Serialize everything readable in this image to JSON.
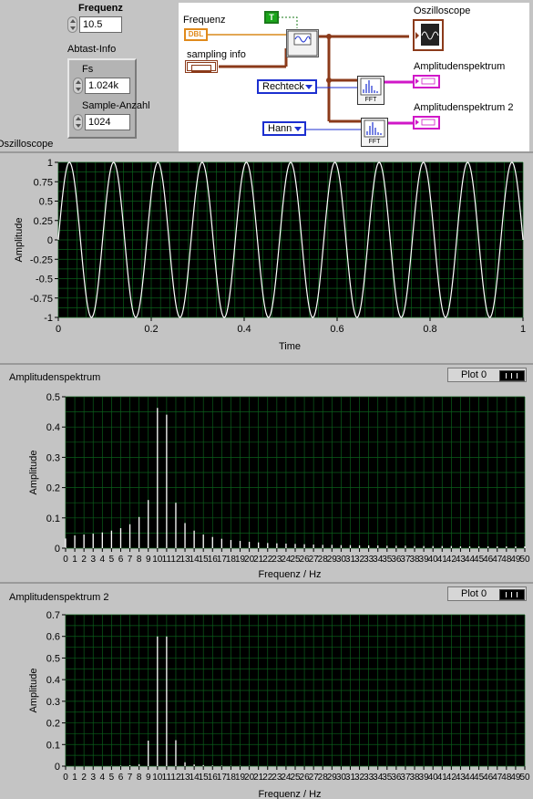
{
  "front_panel": {
    "frequenz": {
      "label": "Frequenz",
      "value": "10.5"
    },
    "abtast_info": {
      "label": "Abtast-Info",
      "fs": {
        "label": "Fs",
        "value": "1.024k"
      },
      "samples": {
        "label": "Sample-Anzahl",
        "value": "1024"
      }
    }
  },
  "block_diagram": {
    "frequenz_label": "Frequenz",
    "frequenz_type": "DBL",
    "sampling_label": "sampling info",
    "bool_const": "T",
    "oszilloscope_label": "Oszilloscope",
    "spectrum1_label": "Amplitudenspektrum",
    "spectrum2_label": "Amplitudenspektrum 2",
    "window1": "Rechteck",
    "window2": "Hann",
    "fft_label": "FFT"
  },
  "graphs": {
    "oszilloscope": {
      "title": "Oszilloscope",
      "xlabel": "Time",
      "ylabel": "Amplitude"
    },
    "spectrum1": {
      "title": "Amplitudenspektrum",
      "legend": "Plot 0",
      "xlabel": "Frequenz / Hz",
      "ylabel": "Amplitude"
    },
    "spectrum2": {
      "title": "Amplitudenspektrum 2",
      "legend": "Plot 0",
      "xlabel": "Frequenz / Hz",
      "ylabel": "Amplitude"
    }
  },
  "chart_data": [
    {
      "type": "line",
      "name": "oszilloscope",
      "title": "Oszilloscope",
      "xlabel": "Time",
      "ylabel": "Amplitude",
      "xlim": [
        0,
        1
      ],
      "ylim": [
        -1,
        1
      ],
      "frequency_hz": 10.5,
      "samples": 1024,
      "xticks": [
        "0",
        "0.2",
        "0.4",
        "0.6",
        "0.8",
        "1"
      ],
      "yticks": [
        "1",
        "0.75",
        "0.5",
        "0.25",
        "0",
        "-0.25",
        "-0.5",
        "-0.75",
        "-1"
      ],
      "grid": true
    },
    {
      "type": "bar",
      "name": "spectrum1",
      "title": "Amplitudenspektrum",
      "xlabel": "Frequenz / Hz",
      "ylabel": "Amplitude",
      "xlim": [
        0,
        50
      ],
      "ylim": [
        0,
        0.5
      ],
      "yticks": [
        "0.5",
        "0.4",
        "0.3",
        "0.2",
        "0.1",
        "0"
      ],
      "x": [
        0,
        1,
        2,
        3,
        4,
        5,
        6,
        7,
        8,
        9,
        10,
        11,
        12,
        13,
        14,
        15,
        16,
        17,
        18,
        19,
        20,
        21,
        22,
        23,
        24,
        25,
        26,
        27,
        28,
        29,
        30,
        31,
        32,
        33,
        34,
        35,
        36,
        37,
        38,
        39,
        40,
        41,
        42,
        43,
        44,
        45,
        46,
        47,
        48,
        49,
        50
      ],
      "values": [
        0.032,
        0.042,
        0.045,
        0.048,
        0.052,
        0.058,
        0.066,
        0.079,
        0.103,
        0.159,
        0.463,
        0.441,
        0.15,
        0.083,
        0.058,
        0.045,
        0.037,
        0.031,
        0.027,
        0.024,
        0.021,
        0.019,
        0.017,
        0.016,
        0.015,
        0.014,
        0.013,
        0.012,
        0.011,
        0.011,
        0.01,
        0.01,
        0.009,
        0.009,
        0.009,
        0.008,
        0.008,
        0.008,
        0.007,
        0.007,
        0.007,
        0.007,
        0.007,
        0.006,
        0.006,
        0.006,
        0.006,
        0.006,
        0.006,
        0.006,
        0.006
      ],
      "grid": true,
      "legend": "Plot 0"
    },
    {
      "type": "bar",
      "name": "spectrum2",
      "title": "Amplitudenspektrum 2",
      "xlabel": "Frequenz / Hz",
      "ylabel": "Amplitude",
      "xlim": [
        0,
        50
      ],
      "ylim": [
        0,
        0.7
      ],
      "yticks": [
        "0.7",
        "0.6",
        "0.5",
        "0.4",
        "0.3",
        "0.2",
        "0.1",
        "0"
      ],
      "x": [
        0,
        1,
        2,
        3,
        4,
        5,
        6,
        7,
        8,
        9,
        10,
        11,
        12,
        13,
        14,
        15,
        16,
        17,
        18,
        19,
        20,
        21,
        22,
        23,
        24,
        25,
        26,
        27,
        28,
        29,
        30,
        31,
        32,
        33,
        34,
        35,
        36,
        37,
        38,
        39,
        40,
        41,
        42,
        43,
        44,
        45,
        46,
        47,
        48,
        49,
        50
      ],
      "values": [
        0,
        0,
        0,
        0,
        0,
        0.001,
        0.002,
        0.004,
        0.009,
        0.118,
        0.6,
        0.6,
        0.12,
        0.018,
        0.008,
        0.005,
        0.003,
        0.002,
        0.001,
        0.001,
        0.001,
        0,
        0,
        0,
        0,
        0,
        0,
        0,
        0,
        0,
        0,
        0,
        0,
        0,
        0,
        0,
        0,
        0,
        0,
        0,
        0,
        0,
        0,
        0,
        0,
        0,
        0,
        0,
        0,
        0,
        0
      ],
      "grid": true,
      "legend": "Plot 0"
    }
  ],
  "xticks_spectrum": [
    "0",
    "1",
    "2",
    "3",
    "4",
    "5",
    "6",
    "7",
    "8",
    "9",
    "10",
    "11",
    "12",
    "13",
    "14",
    "15",
    "16",
    "17",
    "18",
    "19",
    "20",
    "21",
    "22",
    "23",
    "24",
    "25",
    "26",
    "27",
    "28",
    "29",
    "30",
    "31",
    "32",
    "33",
    "34",
    "35",
    "36",
    "37",
    "38",
    "39",
    "40",
    "41",
    "42",
    "43",
    "44",
    "45",
    "46",
    "47",
    "48",
    "49",
    "50"
  ]
}
